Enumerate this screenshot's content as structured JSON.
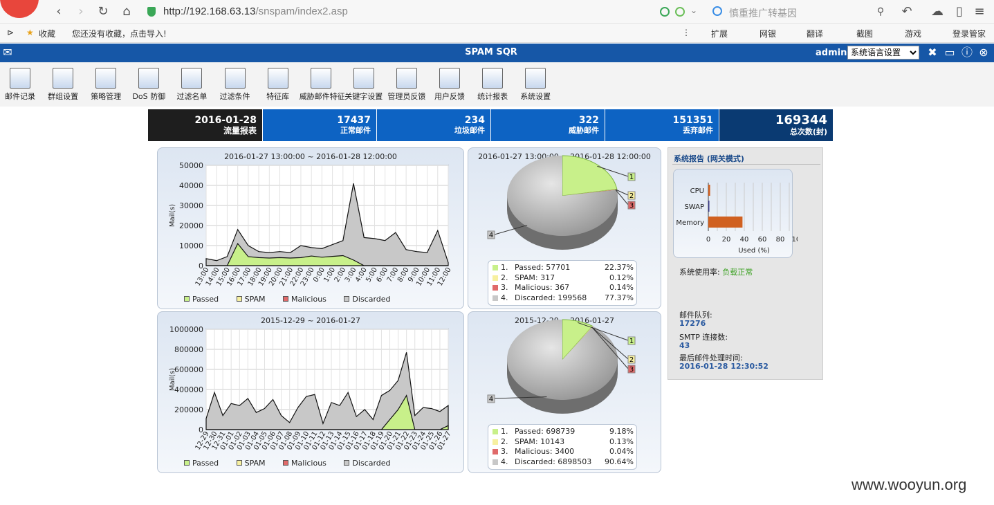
{
  "browser": {
    "url_host": "http://192.168.63.13",
    "url_path": "/snspam/index2.asp",
    "search_placeholder": "慎重推广转基因",
    "bookmarks": {
      "favorites": "收藏",
      "import_hint": "您还没有收藏，点击导入!",
      "extensions": "扩展",
      "bank": "网银",
      "translate": "翻译",
      "screenshot": "截图",
      "games": "游戏",
      "login_manager": "登录管家"
    }
  },
  "app": {
    "title": "SPAM SQR",
    "user": "admin",
    "language_select": "系统语言设置"
  },
  "toolbar": [
    {
      "label": "邮件记录",
      "icon": "mail-log-icon"
    },
    {
      "label": "群组设置",
      "icon": "group-icon"
    },
    {
      "label": "策略管理",
      "icon": "policy-icon"
    },
    {
      "label": "DoS 防御",
      "icon": "dos-defense-icon"
    },
    {
      "label": "过滤名单",
      "icon": "filter-list-icon"
    },
    {
      "label": "过滤条件",
      "icon": "filter-condition-icon"
    },
    {
      "label": "特征库",
      "icon": "signature-db-icon"
    },
    {
      "label": "威胁邮件特征",
      "icon": "threat-signature-icon"
    },
    {
      "label": "关键字设置",
      "icon": "keyword-icon"
    },
    {
      "label": "管理员反馈",
      "icon": "admin-feedback-icon"
    },
    {
      "label": "用户反馈",
      "icon": "user-feedback-icon"
    },
    {
      "label": "统计报表",
      "icon": "statistics-icon"
    },
    {
      "label": "系统设置",
      "icon": "system-settings-icon"
    }
  ],
  "stats": {
    "date": "2016-01-28",
    "date_label": "流量报表",
    "normal": "17437",
    "normal_label": "正常邮件",
    "spam": "234",
    "spam_label": "垃圾邮件",
    "threat": "322",
    "threat_label": "威胁邮件",
    "discarded": "151351",
    "discarded_label": "丢弃邮件",
    "total": "169344",
    "total_label": "总次数(封)"
  },
  "colors": {
    "passed": "#c8f08a",
    "spam": "#f7f0a0",
    "malicious": "#e06a6a",
    "discarded": "#c8c8c8",
    "header": "#1657a7",
    "stat_blue": "#0d63c3",
    "stat_dark": "#0a3a72"
  },
  "legend": {
    "passed": "Passed",
    "spam": "SPAM",
    "malicious": "Malicious",
    "discarded": "Discarded"
  },
  "chart_data": [
    {
      "type": "area",
      "title": "2016-01-27 13:00:00 ~ 2016-01-28 12:00:00",
      "ylabel": "Mail(s)",
      "ylim": [
        0,
        50000
      ],
      "yticks": [
        "0",
        "10000",
        "20000",
        "30000",
        "40000",
        "50000"
      ],
      "categories": [
        "13:00",
        "14:00",
        "15:00",
        "16:00",
        "17:00",
        "18:00",
        "19:00",
        "20:00",
        "21:00",
        "22:00",
        "23:00",
        "0:00",
        "1:00",
        "2:00",
        "3:00",
        "4:00",
        "5:00",
        "6:00",
        "7:00",
        "8:00",
        "9:00",
        "10:00",
        "11:00",
        "12:00"
      ],
      "series": [
        {
          "name": "Passed",
          "values": [
            0,
            0,
            0,
            11000,
            4500,
            4000,
            3800,
            4000,
            3800,
            4000,
            4800,
            4200,
            4600,
            5000,
            2800,
            0,
            0,
            0,
            0,
            0,
            0,
            0,
            0,
            0
          ]
        },
        {
          "name": "Discarded",
          "values": [
            3500,
            2500,
            4500,
            18000,
            10000,
            7000,
            6500,
            7000,
            6500,
            10000,
            9000,
            8500,
            10500,
            12500,
            41000,
            14000,
            13500,
            12500,
            16500,
            8000,
            7000,
            6500,
            17500,
            1500
          ]
        }
      ]
    },
    {
      "type": "pie",
      "title": "2016-01-27 13:00:00 ~ 2016-01-28 12:00:00",
      "rows": [
        {
          "n": "1.",
          "label": "Passed: 57701",
          "pct": "22.37%",
          "value": 22.37
        },
        {
          "n": "2.",
          "label": "SPAM: 317",
          "pct": "0.12%",
          "value": 0.12
        },
        {
          "n": "3.",
          "label": "Malicious: 367",
          "pct": "0.14%",
          "value": 0.14
        },
        {
          "n": "4.",
          "label": "Discarded: 199568",
          "pct": "77.37%",
          "value": 77.37
        }
      ]
    },
    {
      "type": "area",
      "title": "2015-12-29 ~ 2016-01-27",
      "ylabel": "Mail(s)",
      "ylim": [
        0,
        1000000
      ],
      "yticks": [
        "0",
        "200000",
        "400000",
        "600000",
        "800000",
        "1000000"
      ],
      "categories": [
        "12-29",
        "12-30",
        "12-31",
        "01-01",
        "01-02",
        "01-03",
        "01-04",
        "01-05",
        "01-06",
        "01-07",
        "01-08",
        "01-09",
        "01-10",
        "01-11",
        "01-12",
        "01-13",
        "01-14",
        "01-15",
        "01-16",
        "01-17",
        "01-18",
        "01-19",
        "01-20",
        "01-21",
        "01-22",
        "01-23",
        "01-24",
        "01-25",
        "01-26",
        "01-27"
      ],
      "series": [
        {
          "name": "Passed",
          "values": [
            0,
            0,
            0,
            0,
            0,
            0,
            0,
            0,
            0,
            0,
            0,
            0,
            0,
            0,
            0,
            0,
            0,
            0,
            0,
            0,
            0,
            0,
            100000,
            200000,
            340000,
            0,
            0,
            0,
            0,
            40000
          ]
        },
        {
          "name": "Discarded",
          "values": [
            110000,
            370000,
            140000,
            260000,
            240000,
            310000,
            170000,
            210000,
            300000,
            140000,
            70000,
            220000,
            330000,
            350000,
            60000,
            270000,
            240000,
            370000,
            130000,
            200000,
            100000,
            340000,
            390000,
            490000,
            770000,
            140000,
            220000,
            210000,
            180000,
            240000
          ]
        }
      ]
    },
    {
      "type": "pie",
      "title": "2015-12-29 ~ 2016-01-27",
      "rows": [
        {
          "n": "1.",
          "label": "Passed: 698739",
          "pct": "9.18%",
          "value": 9.18
        },
        {
          "n": "2.",
          "label": "SPAM: 10143",
          "pct": "0.13%",
          "value": 0.13
        },
        {
          "n": "3.",
          "label": "Malicious: 3400",
          "pct": "0.04%",
          "value": 0.04
        },
        {
          "n": "4.",
          "label": "Discarded: 6898503",
          "pct": "90.64%",
          "value": 90.64
        }
      ]
    },
    {
      "type": "bar",
      "orientation": "horizontal",
      "categories": [
        "CPU",
        "SWAP",
        "Memory"
      ],
      "values": [
        2,
        1,
        38
      ],
      "xlabel": "Used (%)",
      "xlim": [
        0,
        100
      ],
      "xticks": [
        "0",
        "20",
        "40",
        "60",
        "80",
        "100"
      ]
    }
  ],
  "side": {
    "title": "系统报告 (网关模式)",
    "usage_label": "系统使用率:",
    "usage_value": "负载正常",
    "queue_label": "邮件队列:",
    "queue_value": "17276",
    "smtp_label": "SMTP 连接数:",
    "smtp_value": "43",
    "last_label": "最后邮件处理时间:",
    "last_value": "2016-01-28 12:30:52"
  },
  "watermark": "www.wooyun.org"
}
